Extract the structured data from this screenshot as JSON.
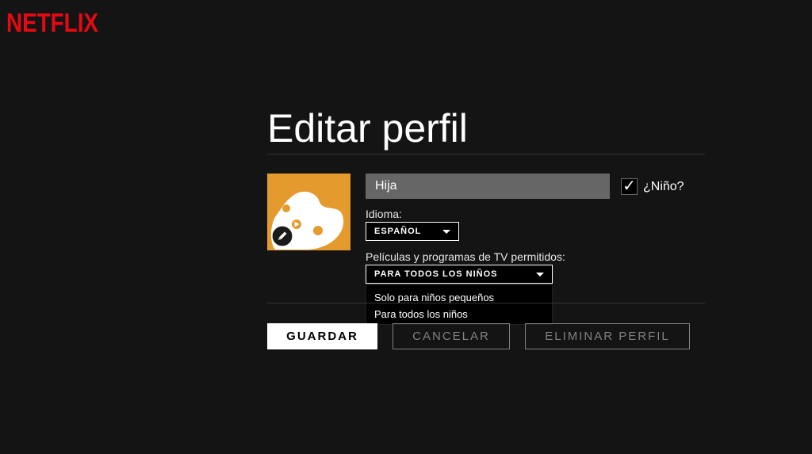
{
  "brand": {
    "logo_text": "NETFLIX",
    "logo_color": "#e50914"
  },
  "page": {
    "title": "Editar perfil"
  },
  "profile": {
    "avatar_icon": "kids-avatar-icon",
    "avatar_color": "#e49a2c",
    "edit_icon": "pencil-icon",
    "name_value": "Hija",
    "kid_checkbox": {
      "checked": true,
      "mark": "✓",
      "label": "¿Niño?"
    }
  },
  "language": {
    "label": "Idioma:",
    "selected": "ESPAÑOL"
  },
  "maturity": {
    "label": "Películas y programas de TV permitidos:",
    "selected": "PARA TODOS LOS NIÑOS",
    "options": [
      "Solo para niños pequeños",
      "Para todos los niños"
    ]
  },
  "actions": {
    "save": "GUARDAR",
    "cancel": "CANCELAR",
    "delete": "ELIMINAR PERFIL"
  }
}
